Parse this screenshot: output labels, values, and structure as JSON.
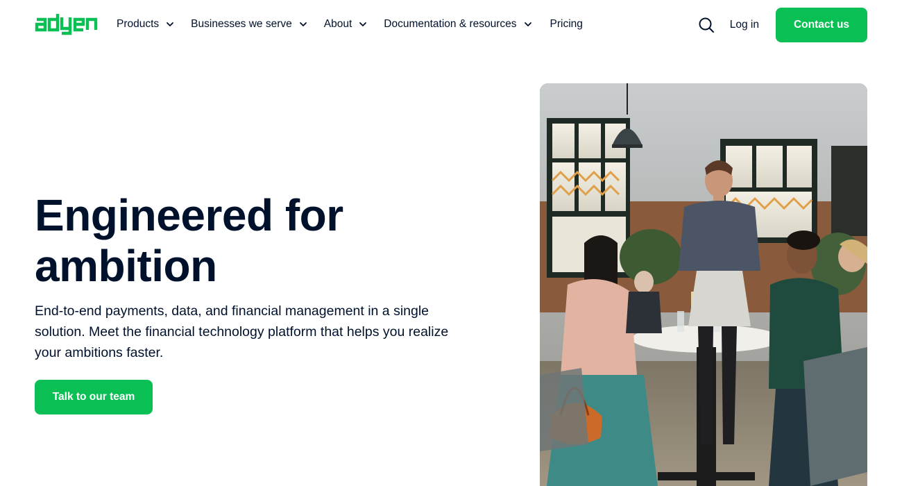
{
  "brand": {
    "logo_text": "adyen",
    "accent_color": "#0abf53",
    "text_color": "#00112c"
  },
  "nav": {
    "items": [
      {
        "label": "Products",
        "has_dropdown": true
      },
      {
        "label": "Businesses we serve",
        "has_dropdown": true
      },
      {
        "label": "About",
        "has_dropdown": true
      },
      {
        "label": "Documentation & resources",
        "has_dropdown": true
      },
      {
        "label": "Pricing",
        "has_dropdown": false
      }
    ],
    "search_icon": "search-icon",
    "login_label": "Log in",
    "contact_label": "Contact us"
  },
  "hero": {
    "title_line1": "Engineered for",
    "title_line2": "ambition",
    "subtitle": "End-to-end payments, data, and financial management in a single solution. Meet the financial technology platform that helps you realize your ambitions faster.",
    "cta_label": "Talk to our team"
  }
}
